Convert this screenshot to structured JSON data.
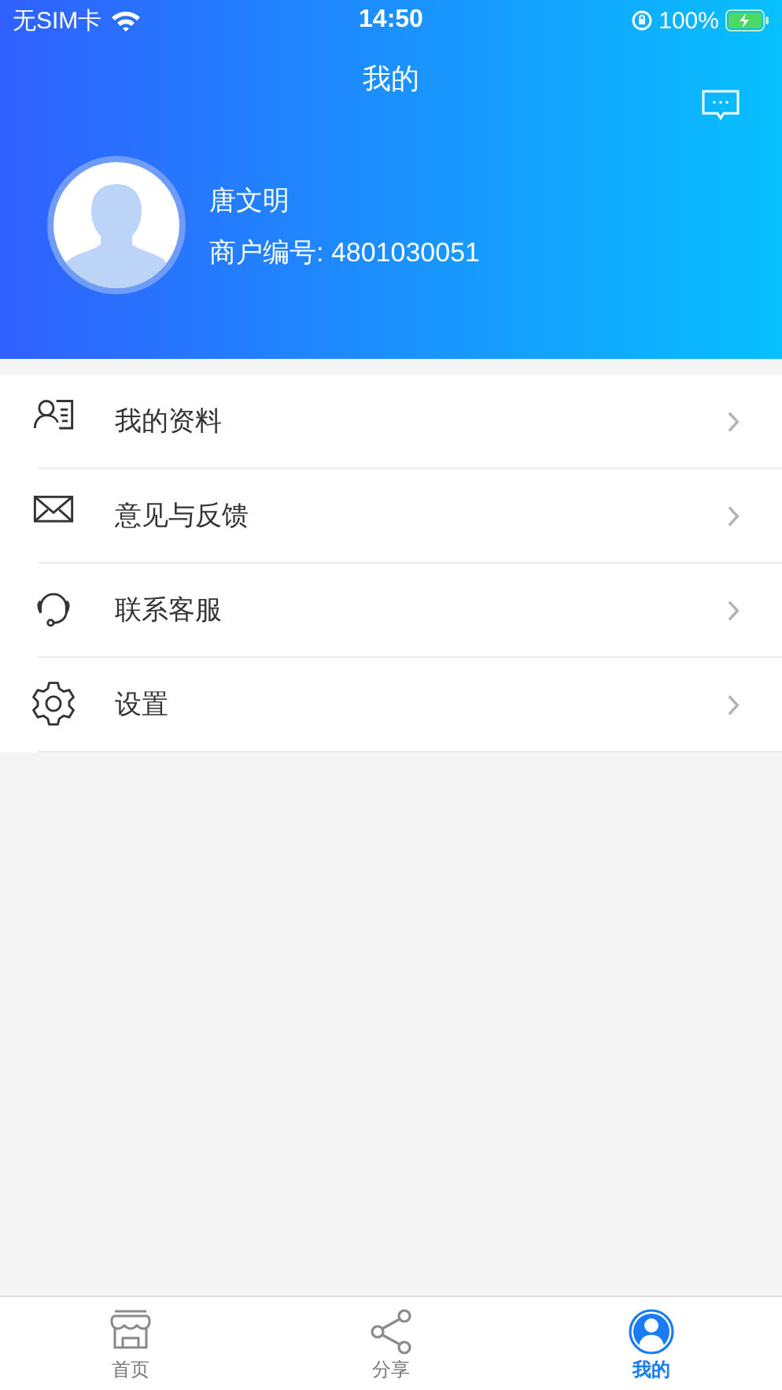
{
  "status_bar": {
    "carrier": "无SIM卡",
    "time": "14:50",
    "battery": "100%"
  },
  "header": {
    "title": "我的",
    "user_name": "唐文明",
    "merchant_id": "商户编号: 4801030051"
  },
  "menu": [
    {
      "label": "我的资料",
      "kind": "profile"
    },
    {
      "label": "意见与反馈",
      "kind": "mail"
    },
    {
      "label": "联系客服",
      "kind": "headset"
    },
    {
      "label": "设置",
      "kind": "gear"
    }
  ],
  "tabs": [
    {
      "label": "首页",
      "kind": "shop",
      "selected": false
    },
    {
      "label": "分享",
      "kind": "share",
      "selected": false
    },
    {
      "label": "我的",
      "kind": "user",
      "selected": true
    }
  ]
}
